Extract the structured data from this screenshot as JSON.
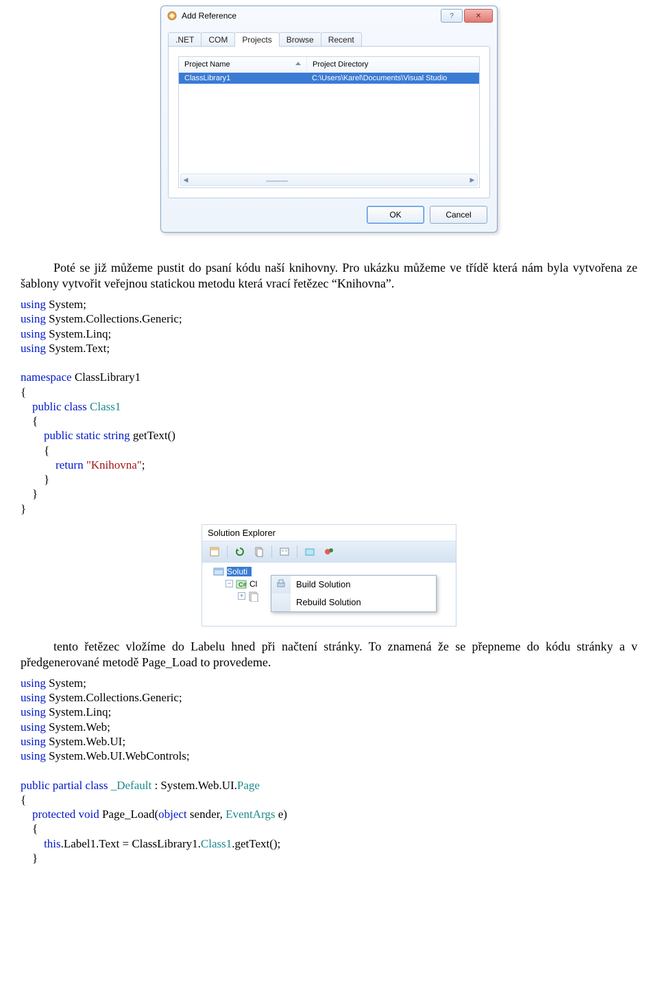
{
  "dialog": {
    "title": "Add Reference",
    "help_btn": "?",
    "close_btn": "✕",
    "tabs": [
      ".NET",
      "COM",
      "Projects",
      "Browse",
      "Recent"
    ],
    "active_tab_index": 2,
    "columns": [
      "Project Name",
      "Project Directory"
    ],
    "rows": [
      {
        "name": "ClassLibrary1",
        "dir": "C:\\Users\\Karel\\Documents\\Visual Studio"
      }
    ],
    "ok": "OK",
    "cancel": "Cancel"
  },
  "para1": "Poté se již můžeme pustit do psaní kódu naší knihovny. Pro ukázku můžeme ve třídě která nám byla vytvořena ze šablony vytvořit veřejnou statickou metodu která vrací řetězec “Knihovna”.",
  "solx": {
    "title": "Solution Explorer",
    "node_solution": "Soluti",
    "node_cl": "Cl",
    "ctx": [
      "Build Solution",
      "Rebuild Solution"
    ]
  },
  "para2": "tento řetězec vložíme do Labelu hned při načtení stránky. To znamená že se přepneme do kódu stránky a v předgenerované metodě Page_Load to provedeme."
}
